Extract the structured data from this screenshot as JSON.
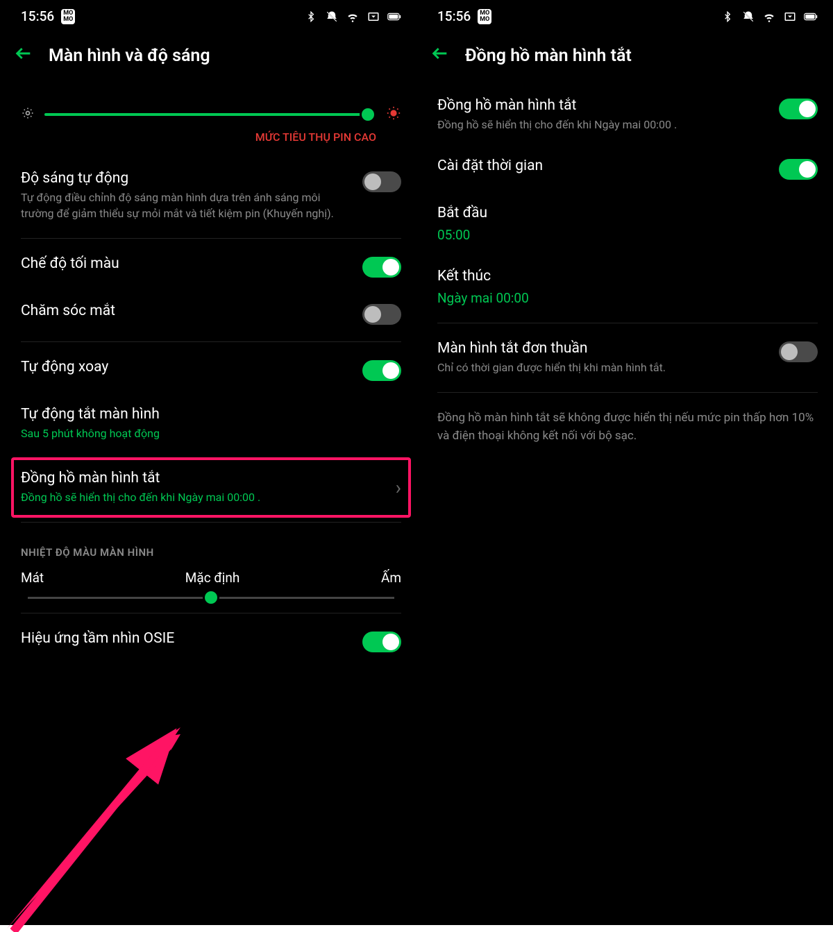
{
  "statusbar": {
    "time": "15:56",
    "momo": "MO\nNO"
  },
  "left": {
    "title": "Màn hình và độ sáng",
    "brightness_warning": "MỨC TIÊU THỤ PIN CAO",
    "auto_bright": {
      "title": "Độ sáng tự động",
      "sub": "Tự động điều chỉnh độ sáng màn hình dựa trên ánh sáng môi trường để giảm thiểu sự mỏi mắt và tiết kiệm pin (Khuyến nghị)."
    },
    "dark_mode": "Chế độ tối màu",
    "eye_care": "Chăm sóc mắt",
    "auto_rotate": "Tự động xoay",
    "auto_off": {
      "title": "Tự động tắt màn hình",
      "sub": "Sau 5 phút không hoạt động"
    },
    "aod": {
      "title": "Đồng hồ màn hình tắt",
      "sub": "Đồng hồ sẽ hiển thị cho đến khi Ngày mai  00:00 ."
    },
    "color_temp_header": "NHIỆT ĐỘ MÀU MÀN HÌNH",
    "cool": "Mát",
    "default": "Mặc định",
    "warm": "Ấm",
    "osie": "Hiệu ứng tầm nhìn OSIE"
  },
  "right": {
    "title": "Đồng hồ màn hình tắt",
    "aod": {
      "title": "Đồng hồ màn hình tắt",
      "sub": "Đồng hồ sẽ hiển thị cho đến khi Ngày mai 00:00 ."
    },
    "time_set": "Cài đặt thời gian",
    "start_label": "Bắt đầu",
    "start_value": "05:00",
    "end_label": "Kết thúc",
    "end_value": "Ngày mai 00:00",
    "simple": {
      "title": "Màn hình tắt đơn thuần",
      "sub": "Chỉ có thời gian được hiển thị khi màn hình tắt."
    },
    "note": "Đồng hồ màn hình tắt sẽ không được hiển thị nếu mức pin thấp hơn 10% và điện thoại không kết nối với bộ sạc."
  }
}
